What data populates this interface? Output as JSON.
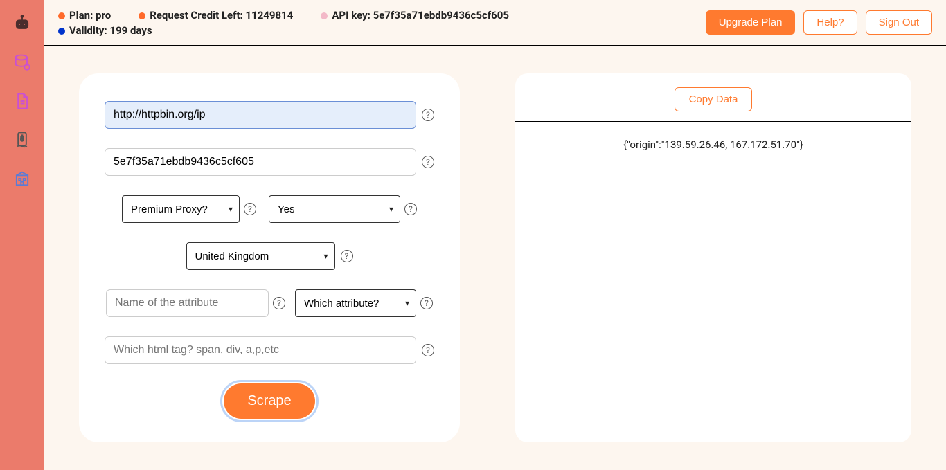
{
  "status": {
    "plan_label": "Plan: pro",
    "credit_label": "Request Credit Left: 11249814",
    "apikey_label": "API key: 5e7f35a71ebdb9436c5cf605",
    "validity_label": "Validity: 199 days"
  },
  "actions": {
    "upgrade": "Upgrade Plan",
    "help": "Help?",
    "signout": "Sign Out"
  },
  "form": {
    "url_value": "http://httpbin.org/ip",
    "apikey_value": "5e7f35a71ebdb9436c5cf605",
    "premium_label": "Premium Proxy?",
    "yesno_value": "Yes",
    "country_value": "United Kingdom",
    "attr_name_placeholder": "Name of the attribute",
    "attr_which_label": "Which attribute?",
    "tag_placeholder": "Which html tag? span, div, a,p,etc",
    "scrape_label": "Scrape"
  },
  "result": {
    "copy_label": "Copy Data",
    "body": "{\"origin\":\"139.59.26.46, 167.172.51.70\"}"
  }
}
